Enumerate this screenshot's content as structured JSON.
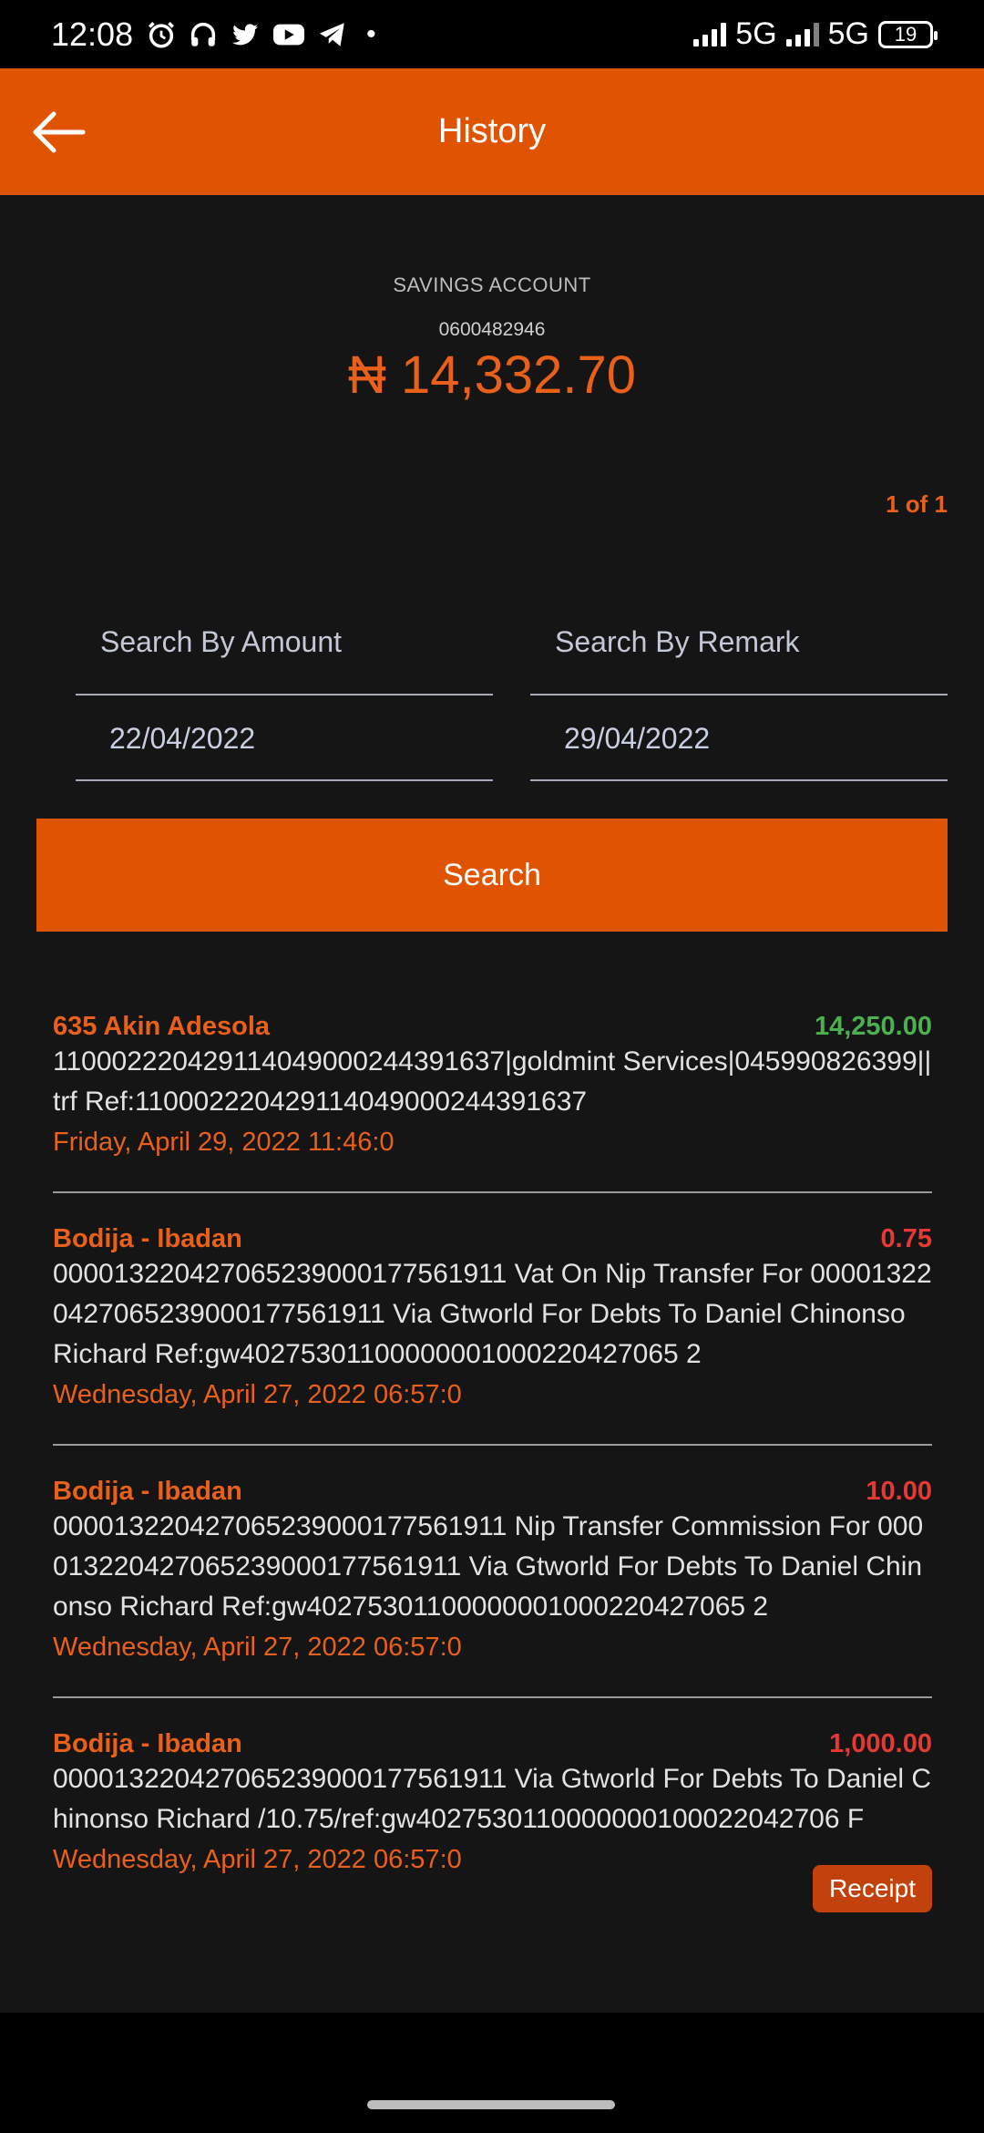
{
  "status_bar": {
    "time": "12:08",
    "network_1": "5G",
    "network_2": "5G",
    "battery": "19"
  },
  "header": {
    "title": "History"
  },
  "account": {
    "type": "SAVINGS ACCOUNT",
    "number": "0600482946",
    "balance": "₦ 14,332.70"
  },
  "pager": "1 of 1",
  "filters": {
    "amount_placeholder": "Search By Amount",
    "remark_placeholder": "Search By Remark",
    "start_date": "22/04/2022",
    "end_date": "29/04/2022",
    "search_label": "Search"
  },
  "transactions": [
    {
      "branch": "635 Akin Adesola",
      "amount": "14,250.00",
      "description": "110002220429114049000244391637|goldmint Services|045990826399||trf Ref:110002220429114049000244391637",
      "date": "Friday, April 29, 2022 11:46:0"
    },
    {
      "branch": "Bodija - Ibadan",
      "amount": "0.75",
      "description": "000013220427065239000177561911 Vat On Nip Transfer For 000013220427065239000177561911 Via Gtworld For Debts To Daniel Chinonso Richard Ref:gw40275301100000001000220427065 2",
      "date": "Wednesday, April 27, 2022 06:57:0"
    },
    {
      "branch": "Bodija - Ibadan",
      "amount": "10.00",
      "description": "000013220427065239000177561911 Nip Transfer Commission For 000013220427065239000177561911 Via Gtworld For Debts To Daniel Chinonso Richard Ref:gw40275301100000001000220427065 2",
      "date": "Wednesday, April 27, 2022 06:57:0"
    },
    {
      "branch": "Bodija - Ibadan",
      "amount": "1,000.00",
      "description": "000013220427065239000177561911 Via Gtworld For Debts To Daniel Chinonso Richard /10.75/ref:gw4027530110000000100022042706 F",
      "date": "Wednesday, April 27, 2022 06:57:0",
      "receipt_label": "Receipt"
    }
  ],
  "colors": {
    "accent": "#e05300",
    "credit": "#4caf50",
    "debit": "#e53935",
    "background": "#151515"
  }
}
